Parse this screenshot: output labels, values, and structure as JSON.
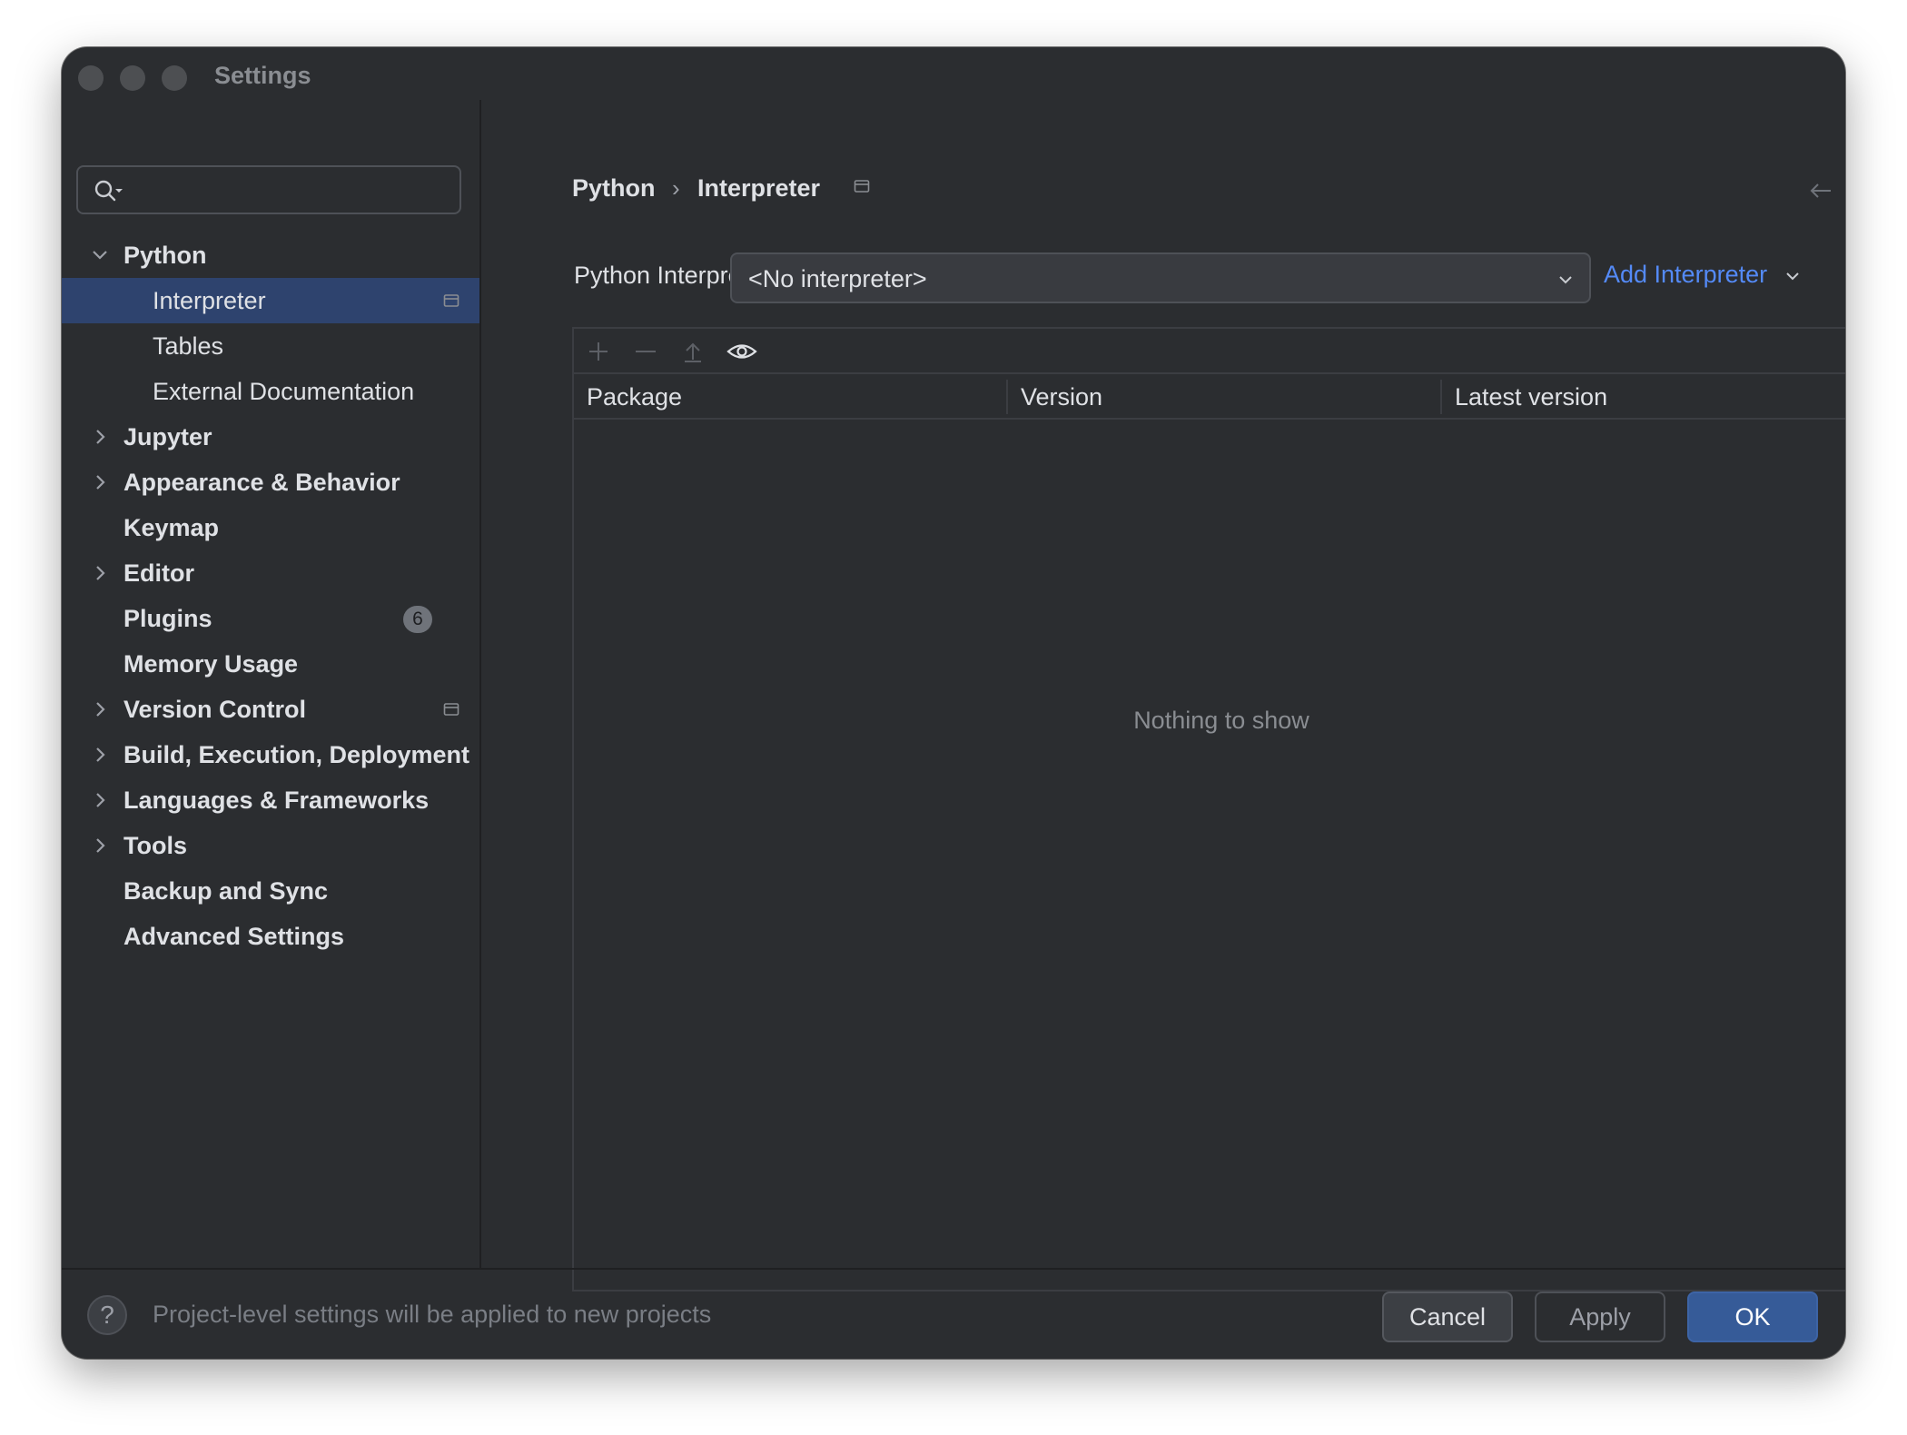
{
  "window": {
    "title": "Settings"
  },
  "search": {
    "placeholder": ""
  },
  "sidebar": {
    "items": [
      {
        "label": "Python",
        "expanded": true,
        "bold": true
      },
      {
        "label": "Interpreter",
        "selected": true
      },
      {
        "label": "Tables"
      },
      {
        "label": "External Documentation"
      },
      {
        "label": "Jupyter",
        "expandable": true,
        "bold": true
      },
      {
        "label": "Appearance & Behavior",
        "expandable": true,
        "bold": true
      },
      {
        "label": "Keymap",
        "bold": true
      },
      {
        "label": "Editor",
        "expandable": true,
        "bold": true
      },
      {
        "label": "Plugins",
        "bold": true,
        "badge": "6"
      },
      {
        "label": "Memory Usage",
        "bold": true
      },
      {
        "label": "Version Control",
        "expandable": true,
        "bold": true
      },
      {
        "label": "Build, Execution, Deployment",
        "expandable": true,
        "bold": true
      },
      {
        "label": "Languages & Frameworks",
        "expandable": true,
        "bold": true
      },
      {
        "label": "Tools",
        "expandable": true,
        "bold": true
      },
      {
        "label": "Backup and Sync",
        "bold": true
      },
      {
        "label": "Advanced Settings",
        "bold": true
      }
    ]
  },
  "breadcrumb": {
    "parent": "Python",
    "separator": "›",
    "current": "Interpreter"
  },
  "interpreter": {
    "label": "Python Interpreter:",
    "value": "<No interpreter>",
    "add_label": "Add Interpreter"
  },
  "table": {
    "columns": [
      "Package",
      "Version",
      "Latest version"
    ],
    "empty_text": "Nothing to show"
  },
  "footer": {
    "help": "?",
    "message": "Project-level settings will be applied to new projects",
    "cancel": "Cancel",
    "apply": "Apply",
    "ok": "OK"
  },
  "colors": {
    "background": "#2b2d30",
    "selection": "#2e436e",
    "link": "#548af7",
    "primary_button": "#365b98"
  }
}
